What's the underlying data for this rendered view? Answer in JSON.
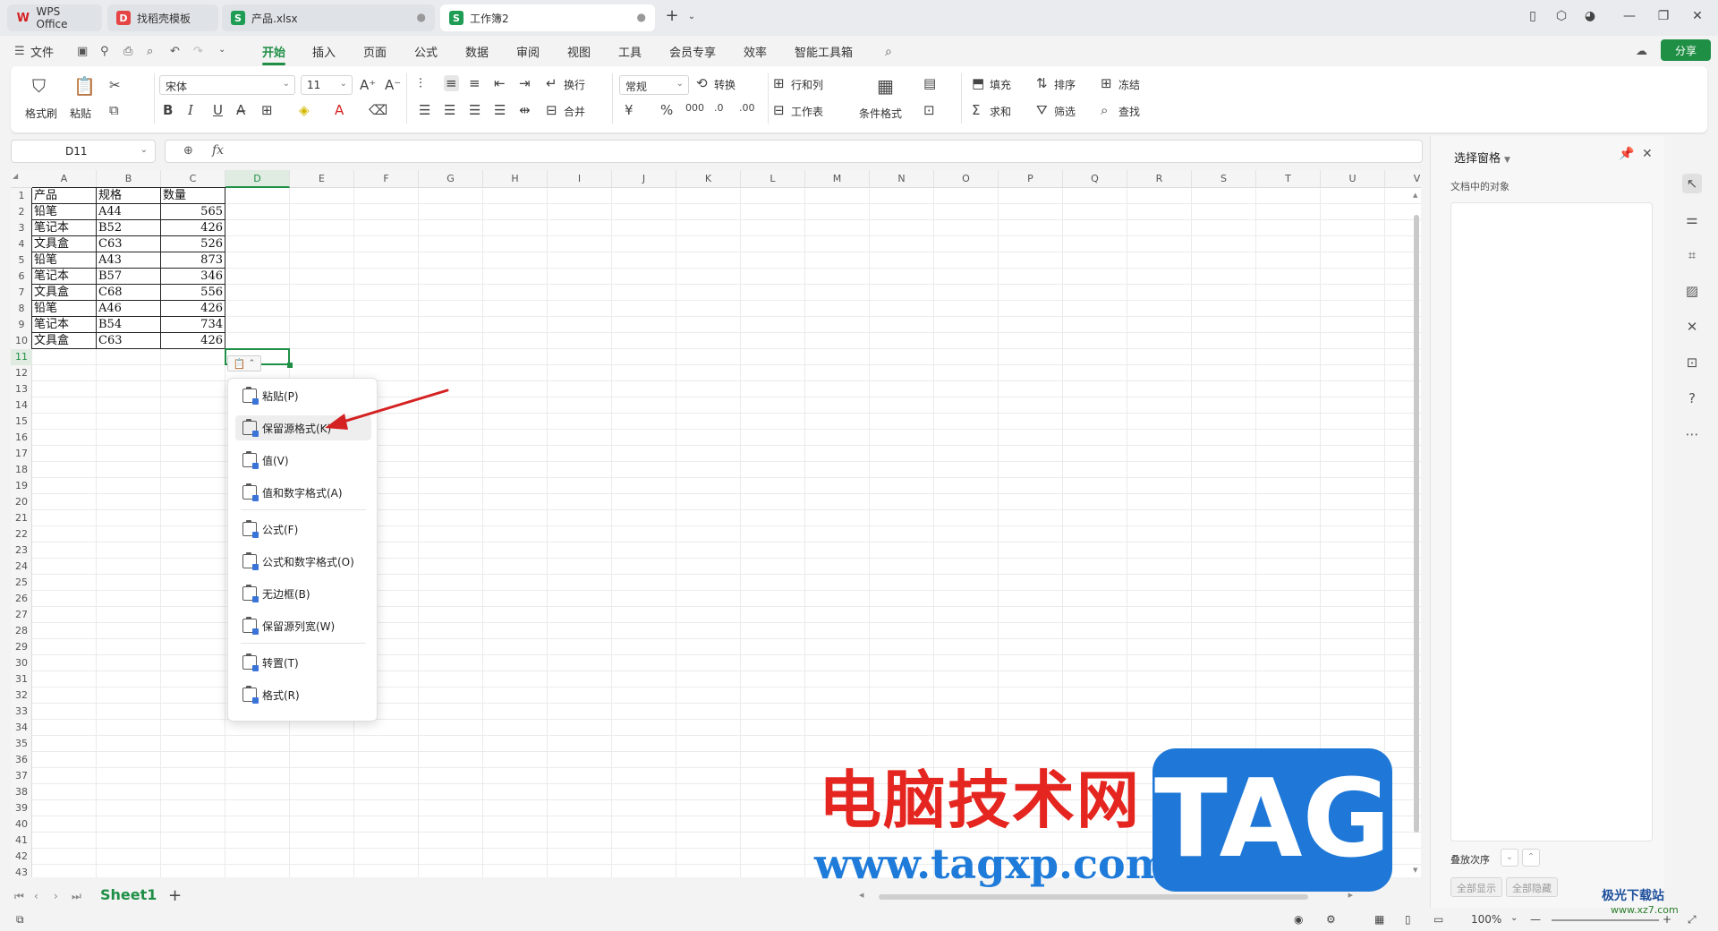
{
  "tabs": [
    {
      "label": "WPS Office",
      "icon": "wps-logo-icon"
    },
    {
      "label": "找稻壳模板",
      "icon": "daoke-icon"
    },
    {
      "label": "产品.xlsx",
      "icon": "sheet-s-icon"
    },
    {
      "label": "工作簿2",
      "icon": "sheet-s-icon"
    }
  ],
  "menu": {
    "file": "文件",
    "items": [
      "开始",
      "插入",
      "页面",
      "公式",
      "数据",
      "审阅",
      "视图",
      "工具",
      "会员专享",
      "效率",
      "智能工具箱"
    ],
    "active": "开始",
    "share": "分享"
  },
  "ribbon": {
    "format_painter": "格式刷",
    "paste": "粘贴",
    "font_name": "宋体",
    "font_size": "11",
    "wrap": "换行",
    "merge": "合并",
    "number_format": "常规",
    "convert": "转换",
    "row_col": "行和列",
    "worksheet": "工作表",
    "cond_format": "条件格式",
    "fill": "填充",
    "sort": "排序",
    "freeze": "冻结",
    "sum": "求和",
    "filter": "筛选",
    "find": "查找",
    "bold": "B",
    "italic": "I",
    "underline": "U",
    "currency": "¥",
    "percent": "%"
  },
  "name_box": "D11",
  "fx": "fx",
  "columns": [
    "A",
    "B",
    "C",
    "D",
    "E",
    "F",
    "G",
    "H",
    "I",
    "J",
    "K",
    "L",
    "M",
    "N",
    "O",
    "P",
    "Q",
    "R",
    "S",
    "T",
    "U",
    "V"
  ],
  "rows": [
    "1",
    "2",
    "3",
    "4",
    "5",
    "6",
    "7",
    "8",
    "9",
    "10",
    "11",
    "12",
    "13",
    "14",
    "15",
    "16",
    "17",
    "18",
    "19",
    "20",
    "21",
    "22",
    "23",
    "24",
    "25",
    "26",
    "27",
    "28",
    "29",
    "30",
    "31",
    "32",
    "33",
    "34",
    "35",
    "36",
    "37",
    "38",
    "39",
    "40",
    "41",
    "42",
    "43"
  ],
  "table": {
    "headers": [
      "产品",
      "规格",
      "数量"
    ],
    "rows": [
      [
        "铅笔",
        "A44",
        "565"
      ],
      [
        "笔记本",
        "B52",
        "426"
      ],
      [
        "文具盒",
        "C63",
        "526"
      ],
      [
        "铅笔",
        "A43",
        "873"
      ],
      [
        "笔记本",
        "B57",
        "346"
      ],
      [
        "文具盒",
        "C68",
        "556"
      ],
      [
        "铅笔",
        "A46",
        "426"
      ],
      [
        "笔记本",
        "B54",
        "734"
      ],
      [
        "文具盒",
        "C63",
        "426"
      ]
    ]
  },
  "paste_menu": {
    "items": [
      "粘贴(P)",
      "保留源格式(K)",
      "值(V)",
      "值和数字格式(A)",
      "公式(F)",
      "公式和数字格式(O)",
      "无边框(B)",
      "保留源列宽(W)",
      "转置(T)",
      "格式(R)"
    ],
    "hovered": "保留源格式(K)"
  },
  "sheet_tab": "Sheet1",
  "zoom": "100%",
  "side_panel": {
    "title": "选择窗格",
    "subtitle": "文档中的对象",
    "order_label": "叠放次序",
    "show_all": "全部显示",
    "hide_all": "全部隐藏"
  },
  "watermark": {
    "cn": "电脑技术网",
    "url": "www.tagxp.com",
    "tag": "TAG",
    "site": "极光下载站",
    "site_url": "www.xz7.com"
  },
  "colors": {
    "accent": "#1f8f46",
    "arrow": "#d42121",
    "tag_blue": "#1f78d7",
    "wm_red": "#e52620"
  }
}
